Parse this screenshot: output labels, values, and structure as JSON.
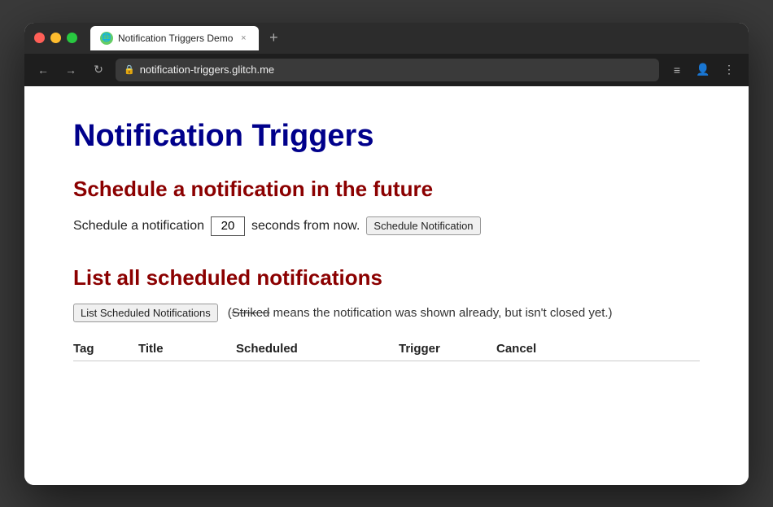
{
  "browser": {
    "traffic_lights": [
      "red",
      "yellow",
      "green"
    ],
    "tab": {
      "icon_label": "🌐",
      "label": "Notification Triggers Demo",
      "close_symbol": "×"
    },
    "new_tab_symbol": "+",
    "nav": {
      "back": "←",
      "forward": "→",
      "reload": "↻"
    },
    "address_bar": {
      "lock_icon": "🔒",
      "url": "notification-triggers.glitch.me"
    },
    "toolbar": {
      "menu_icon": "≡",
      "profile_icon": "👤",
      "more_icon": "⋮"
    }
  },
  "page": {
    "title": "Notification Triggers",
    "schedule_section": {
      "heading": "Schedule a notification in the future",
      "label_before": "Schedule a notification",
      "seconds_value": "20",
      "label_after": "seconds from now.",
      "button_label": "Schedule Notification"
    },
    "list_section": {
      "heading": "List all scheduled notifications",
      "button_label": "List Scheduled Notifications",
      "note_plain": "(",
      "note_striked": "Striked",
      "note_rest": " means the notification was shown already, but isn't closed yet.)",
      "table": {
        "columns": [
          "Tag",
          "Title",
          "Scheduled",
          "Trigger",
          "Cancel"
        ]
      }
    }
  }
}
